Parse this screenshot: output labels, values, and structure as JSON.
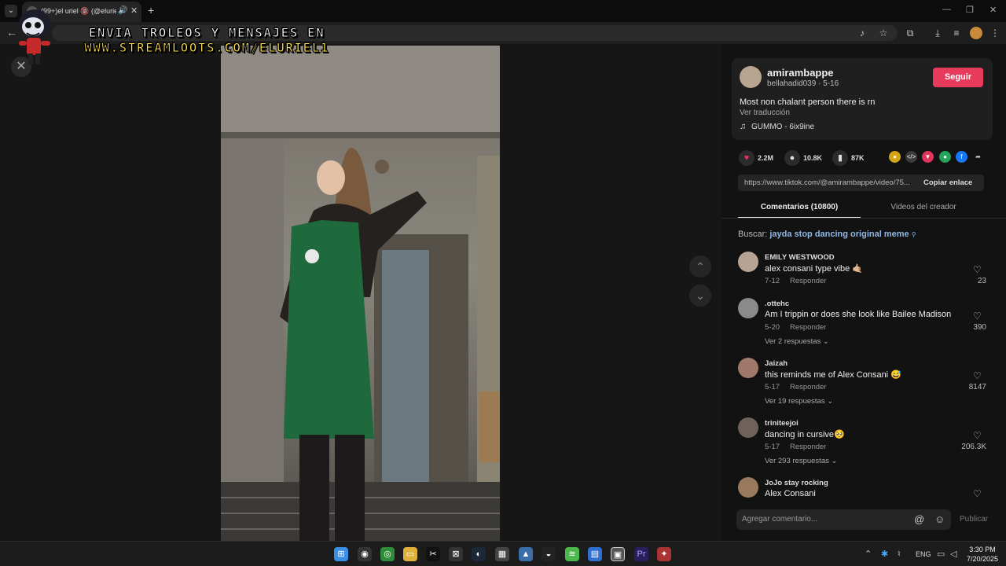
{
  "browser": {
    "tab_title": "(99+)el uriel 🔞 (@eluriel...",
    "tab_audio_icon": "speaker-icon",
    "tab_close_icon": "✕",
    "new_tab_icon": "+",
    "window_controls": [
      "—",
      "❐",
      "✕"
    ]
  },
  "overlay": {
    "line1": "ENVIA TROLEOS Y MENSAJES EN",
    "line2": "WWW.STREAMLOOTS.COM/ELURIEL1"
  },
  "video": {
    "close_icon": "✕",
    "prev_icon": "⌃",
    "next_icon": "⌄"
  },
  "author": {
    "username": "amirambappe",
    "subline": "bellahadid039 · 5-16",
    "follow_label": "Seguir",
    "description": "Most non chalant person there is rn",
    "translate_label": "Ver traducción",
    "music_icon": "♫",
    "music": "GUMMO - 6ix9ine"
  },
  "stats": {
    "likes": "2.2M",
    "comments": "10.8K",
    "saves": "87K"
  },
  "share": {
    "link": "https://www.tiktok.com/@amirambappe/video/75...",
    "copy_label": "Copiar enlace"
  },
  "tabs": {
    "comments": "Comentarios (10800)",
    "creator": "Videos del creador"
  },
  "search": {
    "prefix": "Buscar:",
    "query": "jayda stop dancing original meme"
  },
  "comments": [
    {
      "user": "EMILY WESTWOOD",
      "text": "alex consani type vibe 🤙🏼",
      "date": "7-12",
      "reply": "Responder",
      "likes": "23",
      "replies": ""
    },
    {
      "user": ".ottehc",
      "text": "Am I trippin or does she look like Bailee Madison",
      "date": "5-20",
      "reply": "Responder",
      "likes": "390",
      "replies": "Ver 2 respuestas ⌄"
    },
    {
      "user": "Jaizah",
      "text": "this reminds me of Alex Consani 😅",
      "date": "5-17",
      "reply": "Responder",
      "likes": "8147",
      "replies": "Ver 19 respuestas ⌄"
    },
    {
      "user": "triniteejoi",
      "text": "dancing in cursive🥺",
      "date": "5-17",
      "reply": "Responder",
      "likes": "206.3K",
      "replies": "Ver 293 respuestas ⌄"
    },
    {
      "user": "JoJo stay rocking",
      "text": "Alex Consani",
      "date": "",
      "reply": "",
      "likes": "",
      "replies": ""
    }
  ],
  "composer": {
    "placeholder": "Agregar comentario...",
    "publish_label": "Publicar"
  },
  "taskbar": {
    "lang": "ENG",
    "time": "3:30 PM",
    "date": "7/20/2025"
  }
}
